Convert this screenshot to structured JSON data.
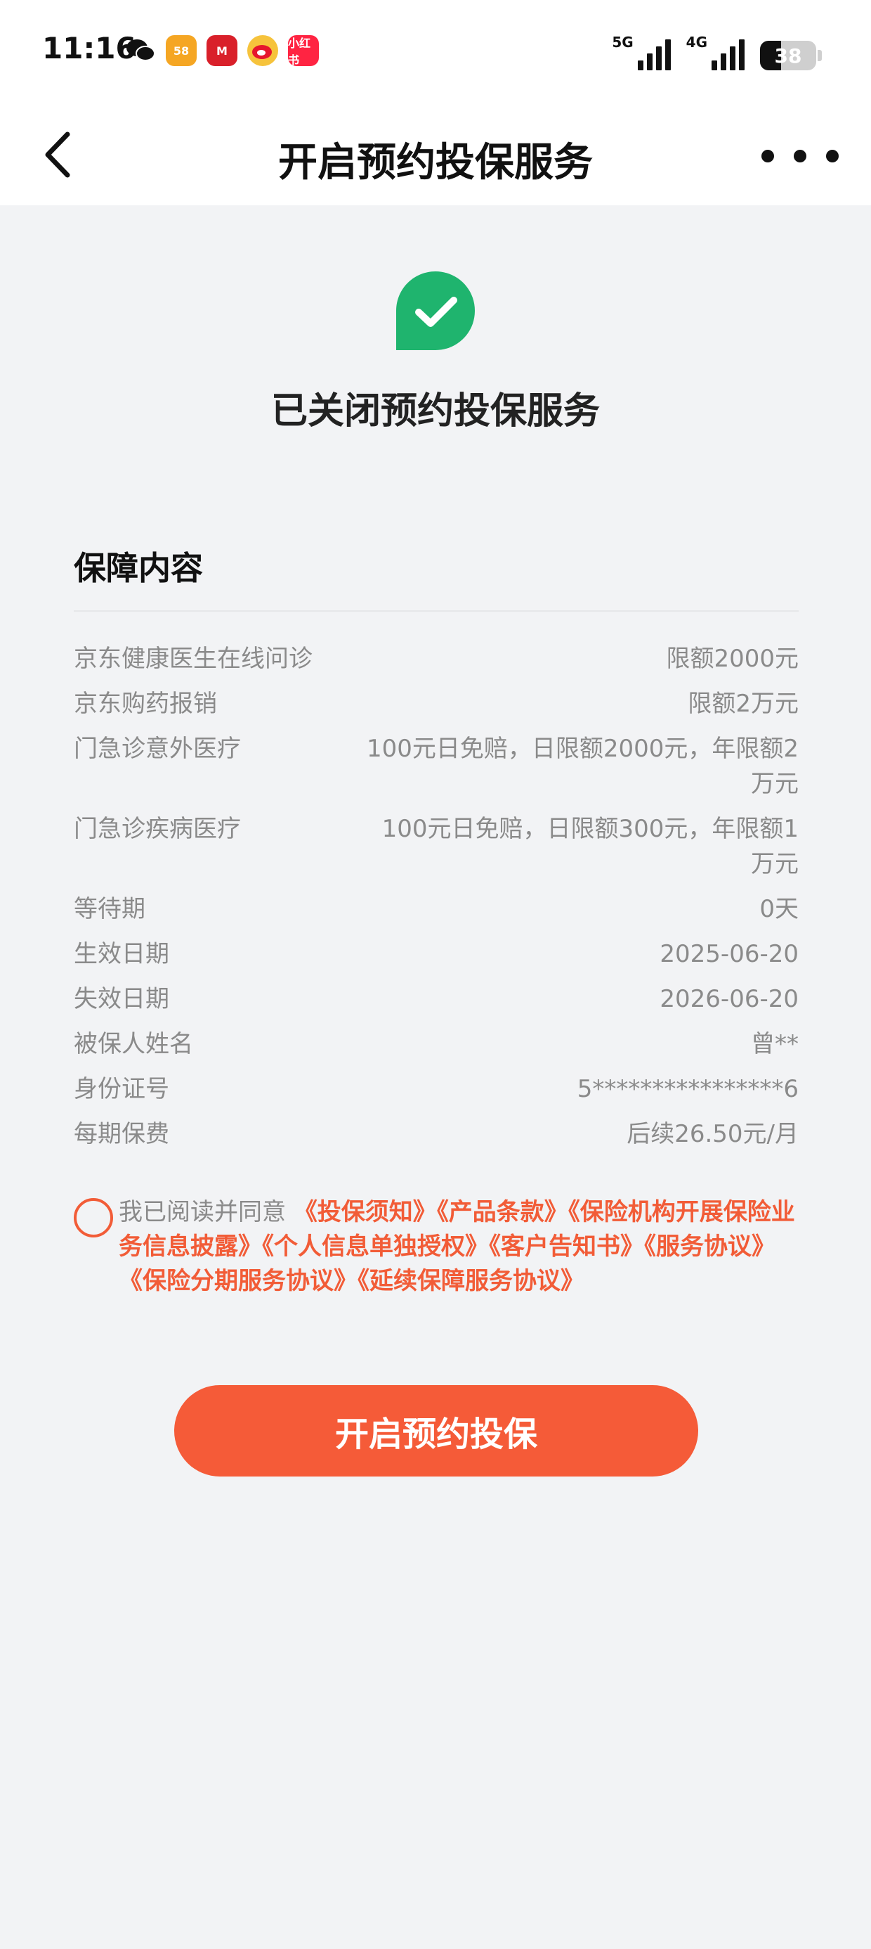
{
  "status_bar": {
    "time": "11:16",
    "app_icons": [
      {
        "name": "wechat-icon",
        "label": "",
        "color": "#111111"
      },
      {
        "name": "58-app-icon",
        "label": "58",
        "color": "#f5a623"
      },
      {
        "name": "cmb-bank-icon",
        "label": "M",
        "color": "#d9202a"
      },
      {
        "name": "weibo-icon",
        "label": "",
        "color": "#f6c33c"
      },
      {
        "name": "xiaohongshu-icon",
        "label": "小红书",
        "color": "#ff2442"
      }
    ],
    "network_1": "5G",
    "network_2": "4G",
    "battery": "38",
    "battery_level": 0.38
  },
  "nav": {
    "title": "开启预约投保服务"
  },
  "result": {
    "title": "已关闭预约投保服务",
    "icon_color": "#1fb46e"
  },
  "section": {
    "title": "保障内容"
  },
  "details": [
    {
      "label": "京东健康医生在线问诊",
      "value": "限额2000元"
    },
    {
      "label": "京东购药报销",
      "value": "限额2万元"
    },
    {
      "label": "门急诊意外医疗",
      "value": "100元日免赔，日限额2000元，年限额2万元"
    },
    {
      "label": "门急诊疾病医疗",
      "value": "100元日免赔，日限额300元，年限额1万元"
    },
    {
      "label": "等待期",
      "value": "0天"
    },
    {
      "label": "生效日期",
      "value": "2025-06-20"
    },
    {
      "label": "失效日期",
      "value": "2026-06-20"
    },
    {
      "label": "被保人姓名",
      "value": "曾**"
    },
    {
      "label": "身份证号",
      "value": "5****************6"
    },
    {
      "label": "每期保费",
      "value": "后续26.50元/月"
    }
  ],
  "agreement": {
    "prefix": "我已阅读并同意",
    "links": [
      "《投保须知》",
      "《产品条款》",
      "《保险机构开展保险业务信息披露》",
      "《个人信息单独授权》",
      "《客户告知书》",
      "《服务协议》",
      "《保险分期服务协议》",
      "《延续保障服务协议》"
    ]
  },
  "button": {
    "label": "开启预约投保"
  },
  "colors": {
    "accent": "#f55b38",
    "success": "#1fb46e",
    "background": "#f2f3f5"
  }
}
